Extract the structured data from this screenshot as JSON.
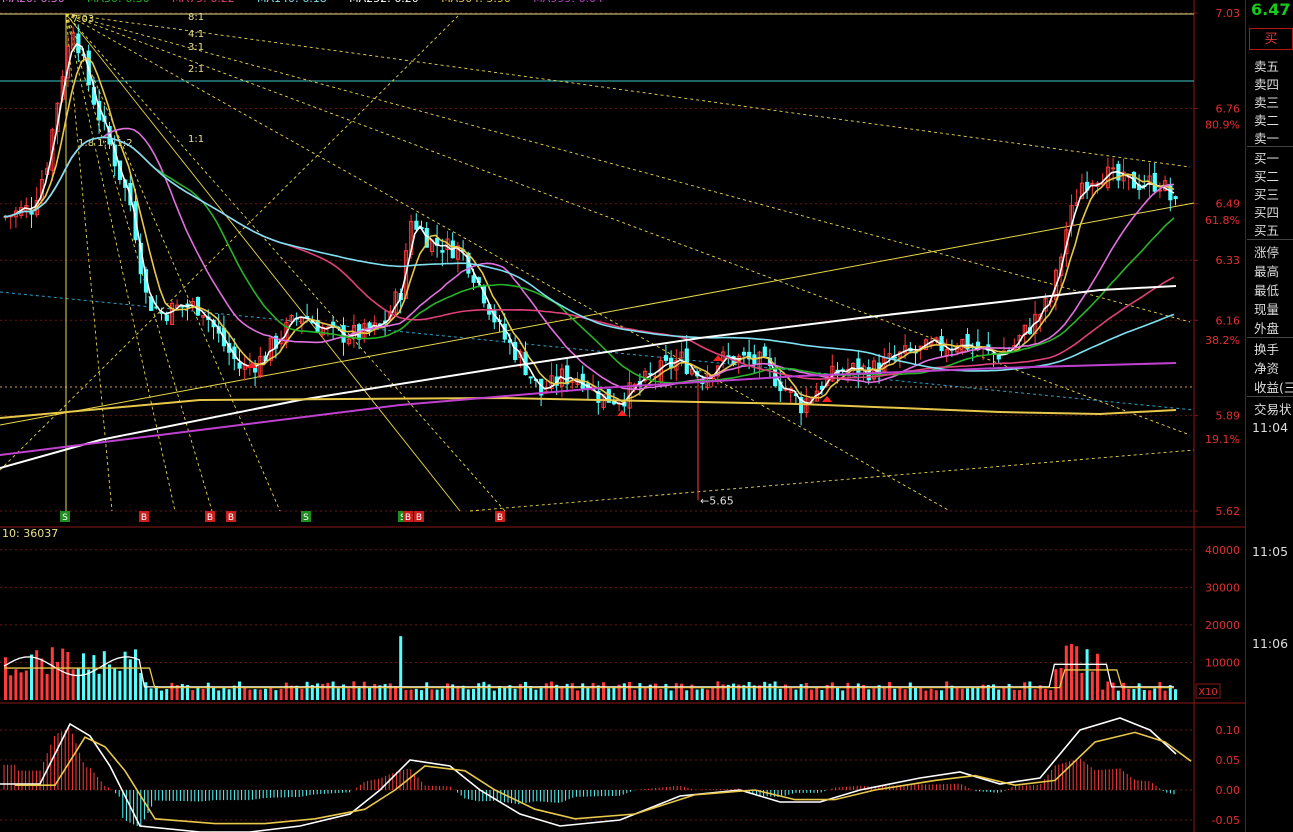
{
  "header": {
    "ma_labels": [
      {
        "text": "MA20: 6.30",
        "color": "#e070e0"
      },
      {
        "text": "MA30: 6.30",
        "color": "#28b428"
      },
      {
        "text": "MA75: 6.22",
        "color": "#e0407a"
      },
      {
        "text": "MA140: 6.18",
        "color": "#7ee0f0"
      },
      {
        "text": "MA252: 6.20",
        "color": "#ffffff"
      },
      {
        "text": "MA504: 5.90",
        "color": "#e8c84a"
      },
      {
        "text": "MA999: 6.04",
        "color": "#c040d0"
      }
    ],
    "peak_label": "7.03",
    "fan_labels": [
      "8:1",
      "4:1",
      "3:1",
      "2:1",
      "1:1"
    ],
    "fan_small_labels": [
      "1:8",
      "1:4",
      "1:2"
    ]
  },
  "price_axis": {
    "ticks": [
      "7.03",
      "6.76",
      "6.49",
      "6.33",
      "6.16",
      "5.89",
      "5.62"
    ],
    "fib": [
      "80.9%",
      "61.8%",
      "38.2%",
      "19.1%"
    ]
  },
  "low_label": "5.65",
  "signals": [
    "S",
    "B",
    "B",
    "B",
    "S",
    "S",
    "B",
    "B",
    "B"
  ],
  "volume": {
    "header": "10: 36037",
    "ticks": [
      "40000",
      "30000",
      "20000",
      "10000"
    ],
    "multiplier": "X10"
  },
  "macd": {
    "ticks": [
      "0.10",
      "0.05",
      "0.00",
      "-0.05"
    ]
  },
  "right_panel": {
    "price": "6.47",
    "price_color": "#19c81e",
    "buy_button": "买",
    "sell_levels": [
      "卖五",
      "卖四",
      "卖三",
      "卖二",
      "卖一"
    ],
    "buy_levels": [
      "买一",
      "买二",
      "买三",
      "买四",
      "买五"
    ],
    "stats": [
      "涨停",
      "最高",
      "最低",
      "现量",
      "外盘"
    ],
    "stats2": [
      "换手",
      "净资",
      "收益(三"
    ],
    "trade_status": "交易状",
    "times": [
      "11:04",
      "11:05",
      "11:06"
    ]
  },
  "colors": {
    "up": "#ff3a3a",
    "down": "#54ffff",
    "grid": "#8a1818",
    "axis_text": "#e03030"
  }
}
